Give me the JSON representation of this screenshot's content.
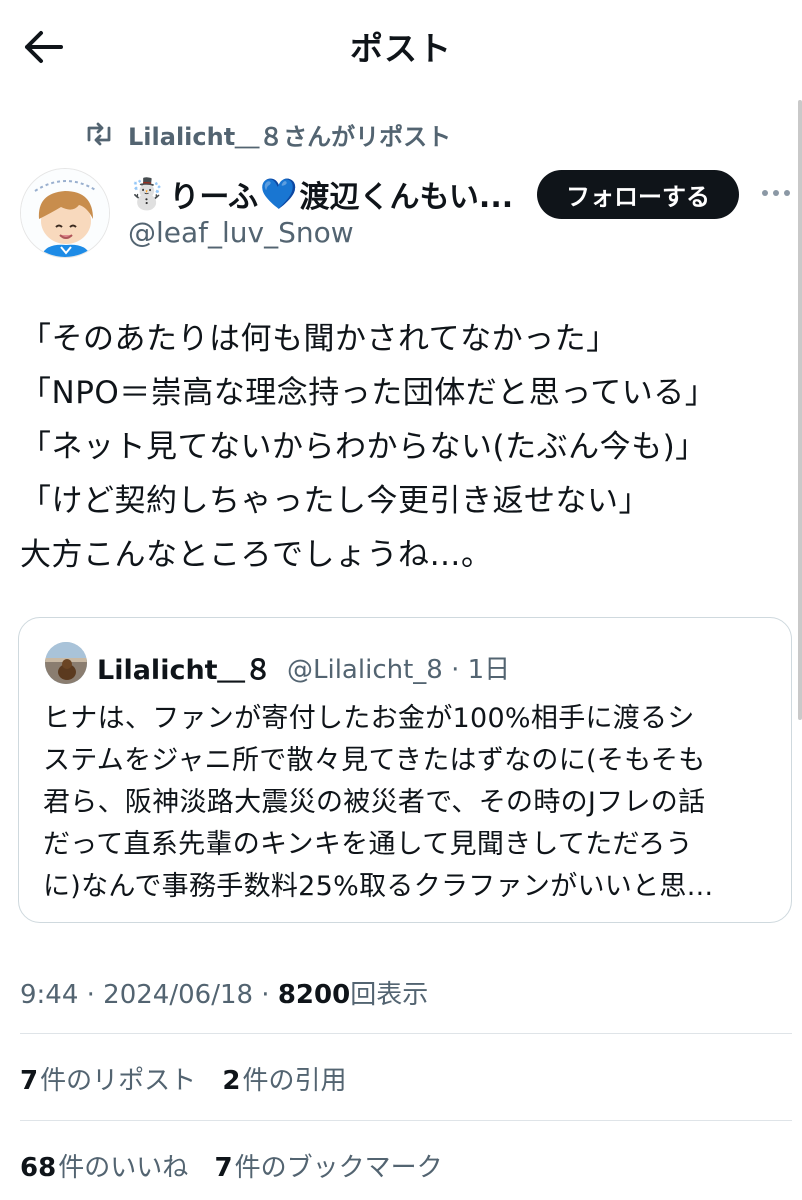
{
  "header": {
    "title": "ポスト",
    "back_icon": "arrow-left-icon"
  },
  "repost_banner": {
    "icon": "repost-icon",
    "text": "Lilalicht＿８さんがリポスト"
  },
  "author": {
    "emoji": "☃️",
    "name_part1": "りーふ",
    "heart": "💙",
    "name_part2": "渡辺くんもい...",
    "handle": "@leaf_luv_Snow",
    "follow_label": "フォローする"
  },
  "post": {
    "lines": [
      "「そのあたりは何も聞かされてなかった」",
      "「NPO＝崇高な理念持った団体だと思っている」",
      "「ネット見てないからわからない(たぶん今も)」",
      "「けど契約しちゃったし今更引き返せない」",
      "大方こんなところでしょうね…。"
    ]
  },
  "quote": {
    "name": "Lilalicht＿８",
    "handle_time": "@Lilalicht_8 · 1日",
    "lines": [
      "ヒナは、ファンが寄付したお金が100%相手に渡るシ",
      "ステムをジャニ所で散々見てきたはずなのに(そもそも",
      "君ら、阪神淡路大震災の被災者で、その時のJフレの話",
      "だって直系先輩のキンキを通して見聞きしてただろう",
      "に)なんで事務手数料25%取るクラファンがいいと思..."
    ]
  },
  "meta": {
    "time_date": "9:44 · 2024/06/18 · ",
    "views_count": "8200",
    "views_label": "回表示"
  },
  "stats": {
    "reposts_count": "7",
    "reposts_label": "件のリポスト",
    "quotes_count": "2",
    "quotes_label": "件の引用",
    "likes_count": "68",
    "likes_label": "件のいいね",
    "bookmarks_count": "7",
    "bookmarks_label": "件のブックマーク"
  },
  "colors": {
    "text": "#0f1419",
    "secondary": "#536471",
    "border": "#cfd9de",
    "follow_bg": "#0f1419"
  }
}
